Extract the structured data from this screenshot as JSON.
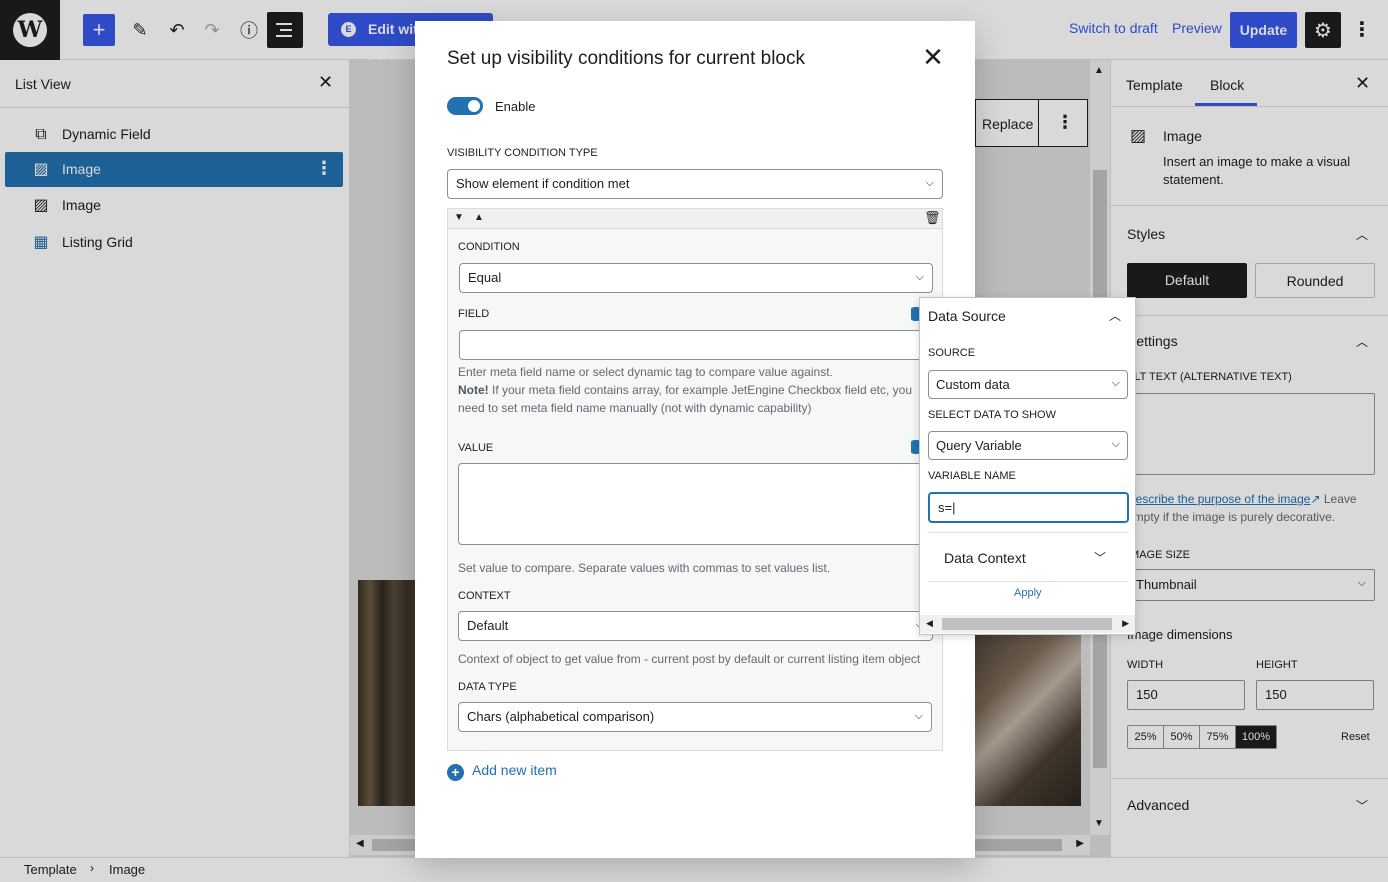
{
  "toolbar": {
    "edit_with_label": "Edit with Elementor",
    "switch_to_draft": "Switch to draft",
    "preview": "Preview",
    "update": "Update"
  },
  "list_view": {
    "title": "List View",
    "items": [
      {
        "label": "Dynamic Field",
        "icon": "dynamic-field-icon"
      },
      {
        "label": "Image",
        "icon": "image-icon",
        "selected": true
      },
      {
        "label": "Image",
        "icon": "image-icon"
      },
      {
        "label": "Listing Grid",
        "icon": "listing-grid-icon"
      }
    ]
  },
  "canvas": {
    "replace_label": "Replace"
  },
  "modal": {
    "title": "Set up visibility conditions for current block",
    "enable_label": "Enable",
    "visibility_type_label": "VISIBILITY CONDITION TYPE",
    "visibility_type_value": "Show element if condition met",
    "condition_label": "CONDITION",
    "condition_value": "Equal",
    "field_label": "FIELD",
    "field_value": "",
    "field_help": "Enter meta field name or select dynamic tag to compare value against.",
    "field_note_bold": "Note!",
    "field_note": " If your meta field contains array, for example JetEngine Checkbox field etc, you need to set meta field name manually (not with dynamic capability)",
    "value_label": "VALUE",
    "value_help": "Set value to compare. Separate values with commas to set values list.",
    "context_label": "CONTEXT",
    "context_value": "Default",
    "context_help": "Context of object to get value from - current post by default or current listing item object",
    "data_type_label": "DATA TYPE",
    "data_type_value": "Chars (alphabetical comparison)",
    "add_new_item": "Add new item"
  },
  "data_source": {
    "title": "Data Source",
    "source_label": "SOURCE",
    "source_value": "Custom data",
    "select_label": "SELECT DATA TO SHOW",
    "select_value": "Query Variable",
    "variable_label": "VARIABLE NAME",
    "variable_value": "s=",
    "data_context": "Data Context",
    "apply": "Apply"
  },
  "sidebar": {
    "tab_template": "Template",
    "tab_block": "Block",
    "block_name": "Image",
    "block_desc": "Insert an image to make a visual statement.",
    "styles_title": "Styles",
    "style_default": "Default",
    "style_rounded": "Rounded",
    "settings_title": "Settings",
    "alt_label": "ALT TEXT (ALTERNATIVE TEXT)",
    "alt_link": "Describe the purpose of the image",
    "alt_help": "Leave empty if the image is purely decorative.",
    "size_label": "IMAGE SIZE",
    "size_value": "Thumbnail",
    "dimensions_title": "Image dimensions",
    "width_label": "WIDTH",
    "height_label": "HEIGHT",
    "width_value": "150",
    "height_value": "150",
    "pcts": [
      "25%",
      "50%",
      "75%",
      "100%"
    ],
    "reset": "Reset",
    "advanced_title": "Advanced"
  },
  "footer": {
    "crumb1": "Template",
    "crumb2": "Image"
  }
}
